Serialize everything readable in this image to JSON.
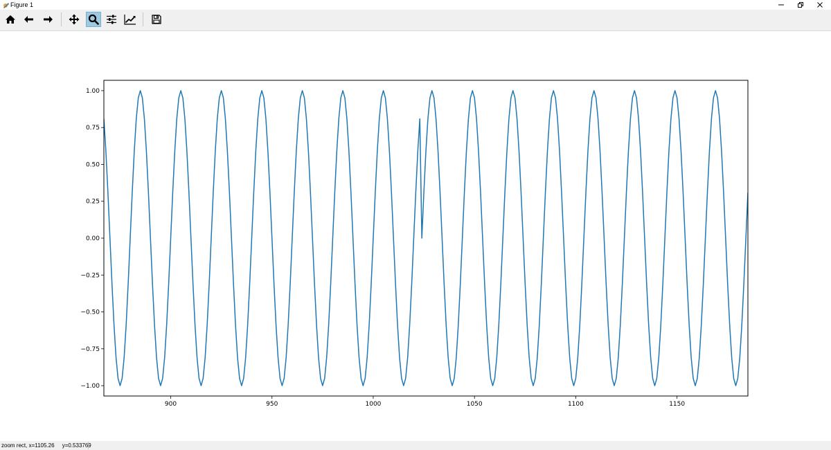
{
  "window": {
    "title": "Figure 1",
    "controls": {
      "minimize_icon": "minimize-icon",
      "restore_icon": "restore-icon",
      "close_icon": "close-icon"
    }
  },
  "toolbar": {
    "buttons": [
      {
        "name": "home-button",
        "icon": "home-icon"
      },
      {
        "name": "back-button",
        "icon": "arrow-left-icon"
      },
      {
        "name": "forward-button",
        "icon": "arrow-right-icon"
      },
      {
        "name": "pan-button",
        "icon": "move-icon"
      },
      {
        "name": "zoom-button",
        "icon": "magnifier-icon",
        "active": true
      },
      {
        "name": "configure-subplots-button",
        "icon": "sliders-icon"
      },
      {
        "name": "edit-axes-button",
        "icon": "line-chart-icon"
      },
      {
        "name": "save-button",
        "icon": "floppy-disk-icon"
      }
    ],
    "active_color": "#9ecae1"
  },
  "chart_data": {
    "type": "line",
    "xlim": [
      867,
      1185
    ],
    "ylim": [
      -1.07,
      1.07
    ],
    "xticks": [
      900,
      950,
      1000,
      1050,
      1100,
      1150
    ],
    "yticks": [
      -1.0,
      -0.75,
      -0.5,
      -0.25,
      0.0,
      0.25,
      0.5,
      0.75,
      1.0
    ],
    "xtick_labels": [
      "900",
      "950",
      "1000",
      "1050",
      "1100",
      "1150"
    ],
    "ytick_labels": [
      "−1.00",
      "−0.75",
      "−0.50",
      "−0.25",
      "0.00",
      "0.25",
      "0.50",
      "0.75",
      "1.00"
    ],
    "line_color": "#1f77b4",
    "grid": false,
    "series": [
      {
        "waveform": "sin(2*pi*x/20)",
        "first_segment_x": [
          867,
          1023
        ],
        "discontinuity": {
          "x": 1024,
          "y": 0.0
        },
        "second_segment_x": [
          1024,
          1185
        ]
      }
    ]
  },
  "status": {
    "mode": "zoom rect,",
    "x_readout": "x=1105.26",
    "y_readout": "y=0.533769"
  }
}
